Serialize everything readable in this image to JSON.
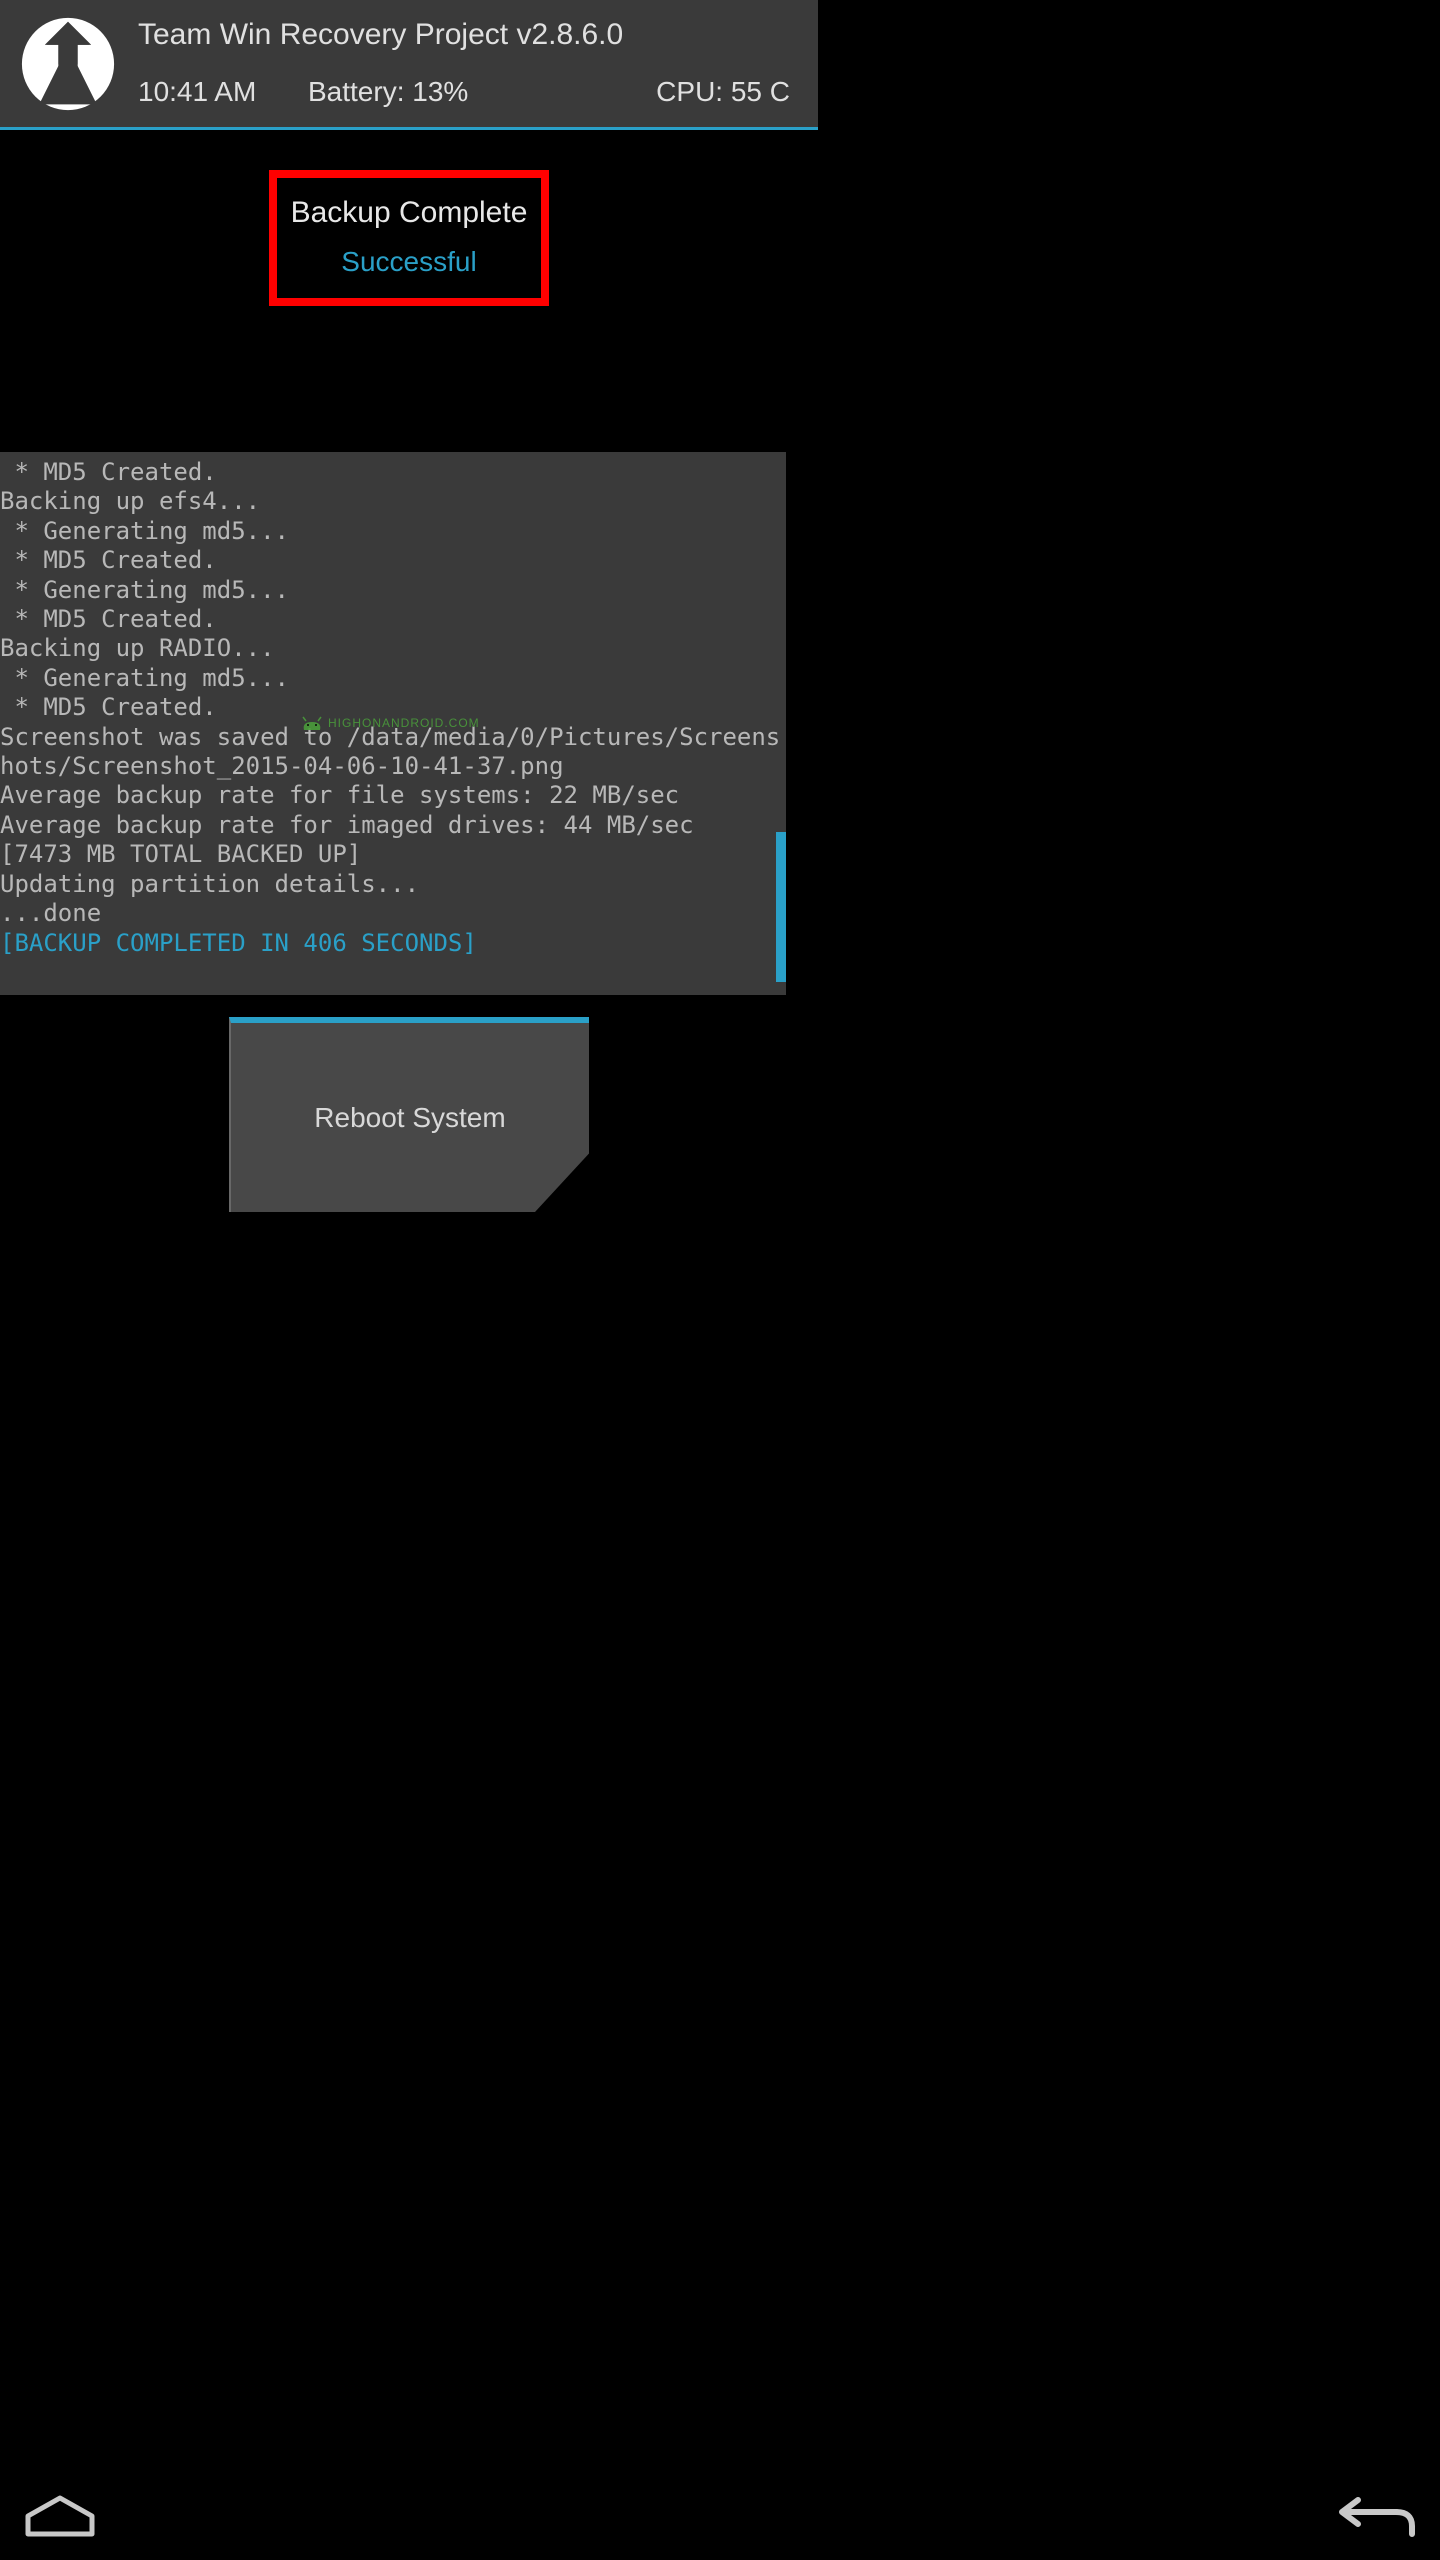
{
  "header": {
    "title": "Team Win Recovery Project  v2.8.6.0",
    "time": "10:41 AM",
    "battery": "Battery: 13%",
    "cpu": "CPU: 55 C"
  },
  "highlight": {
    "title": "Backup Complete",
    "subtitle": "Successful"
  },
  "console": {
    "lines": [
      " * MD5 Created.",
      "Backing up efs4...",
      " * Generating md5...",
      " * MD5 Created.",
      " * Generating md5...",
      " * MD5 Created.",
      "Backing up RADIO...",
      " * Generating md5...",
      " * MD5 Created.",
      "Screenshot was saved to /data/media/0/Pictures/Screenshots/Screenshot_2015-04-06-10-41-37.png",
      "Average backup rate for file systems: 22 MB/sec",
      "Average backup rate for imaged drives: 44 MB/sec",
      "[7473 MB TOTAL BACKED UP]",
      "Updating partition details...",
      "...done"
    ],
    "final_line": "[BACKUP COMPLETED IN 406 SECONDS]"
  },
  "button": {
    "reboot": "Reboot System"
  },
  "watermark": "HIGHONANDROID.COM"
}
